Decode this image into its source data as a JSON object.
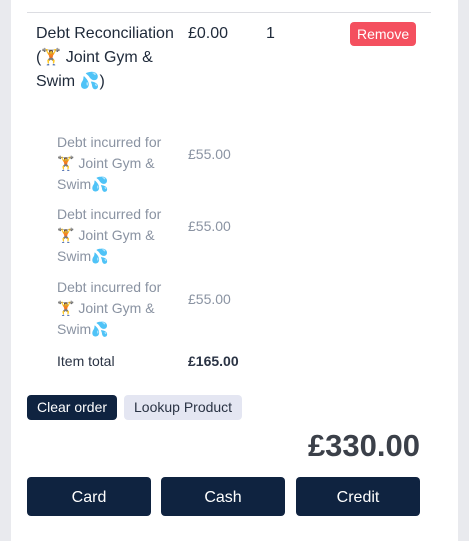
{
  "order_line": {
    "description": "Debt Reconciliation (🏋️ Joint Gym & Swim 💦)",
    "price": "£0.00",
    "quantity": "1",
    "remove_label": "Remove"
  },
  "sub_items": [
    {
      "description": "Debt incurred for 🏋️ Joint Gym & Swim💦",
      "price": "£55.00"
    },
    {
      "description": "Debt incurred for 🏋️ Joint Gym & Swim💦",
      "price": "£55.00"
    },
    {
      "description": "Debt incurred for 🏋️ Joint Gym & Swim💦",
      "price": "£55.00"
    }
  ],
  "item_total": {
    "label": "Item total",
    "value": "£165.00"
  },
  "actions": {
    "clear_order_label": "Clear order",
    "lookup_product_label": "Lookup Product"
  },
  "grand_total": "£330.00",
  "payment": {
    "card_label": "Card",
    "cash_label": "Cash",
    "credit_label": "Credit"
  },
  "colors": {
    "primary": "#0f2340",
    "danger": "#f4505f",
    "muted_text": "#8a93a2"
  }
}
